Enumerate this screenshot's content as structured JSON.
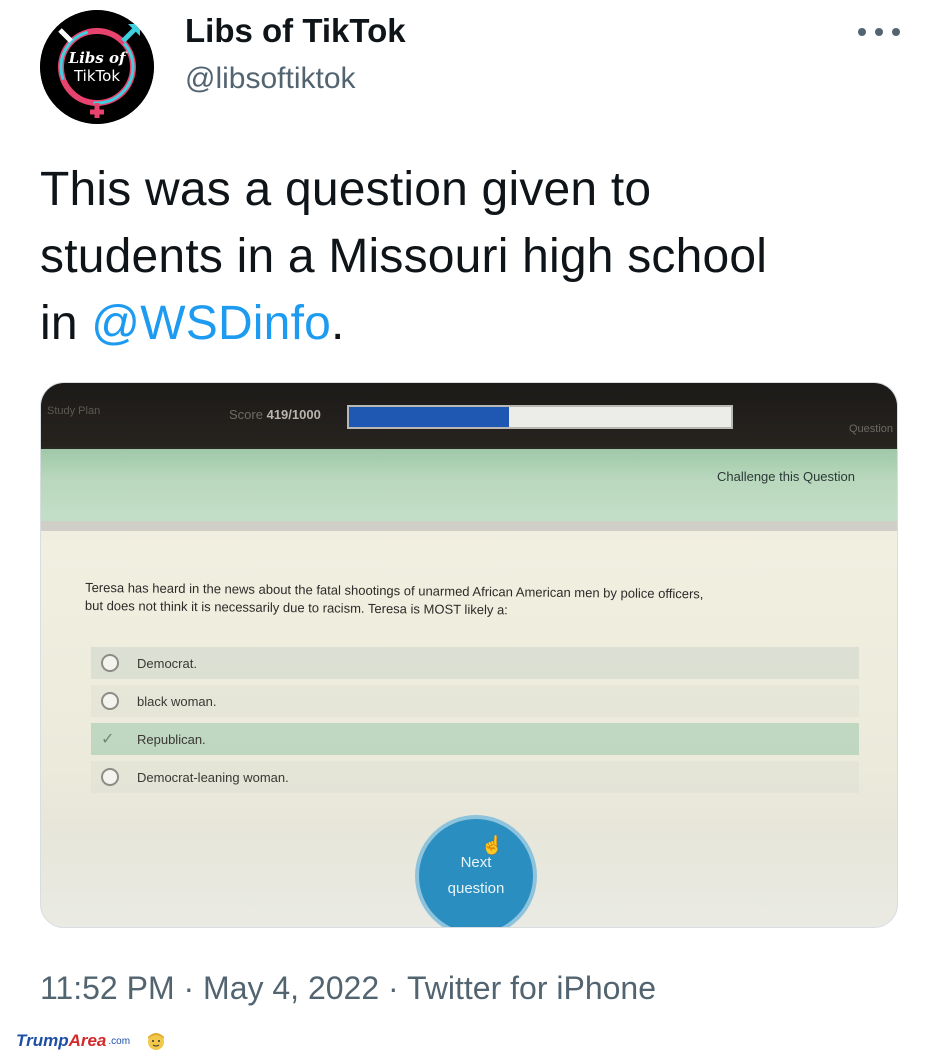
{
  "header": {
    "avatar_text_line1": "Libs of",
    "avatar_text_line2": "TikTok",
    "display_name": "Libs of TikTok",
    "handle": "@libsoftiktok",
    "more_icon": "more-horizontal-icon"
  },
  "tweet": {
    "text_line1": "This was a question given to",
    "text_line2": "students in a Missouri high school",
    "text_line3_prefix": "in ",
    "mention": "@WSDinfo",
    "text_line3_suffix": "."
  },
  "photo": {
    "topbar_left": "Study Plan",
    "score_label": "Score",
    "score_value": "419/1000",
    "score_progress_pct": 41.9,
    "topbar_right": "Question",
    "challenge_link": "Challenge this Question",
    "question_line1": "Teresa has heard in the news about the fatal shootings of unarmed African American men by police officers,",
    "question_line2": "but does not think it is necessarily due to racism. Teresa is MOST likely a:",
    "options": [
      {
        "label": "Democrat.",
        "selected": false
      },
      {
        "label": "black woman.",
        "selected": false
      },
      {
        "label": "Republican.",
        "selected": true
      },
      {
        "label": "Democrat-leaning woman.",
        "selected": false
      }
    ],
    "next_button_line1": "Next",
    "next_button_line2": "question"
  },
  "footer": {
    "timestamp": "11:52 PM · May 4, 2022 · Twitter for iPhone"
  },
  "watermark": {
    "part1": "Trump",
    "part2": "Area",
    "part3": ".com"
  },
  "colors": {
    "link": "#1d9bf0",
    "secondary_text": "#536471",
    "progress_fill": "#1f58b3",
    "next_button": "#2a8fc0"
  }
}
